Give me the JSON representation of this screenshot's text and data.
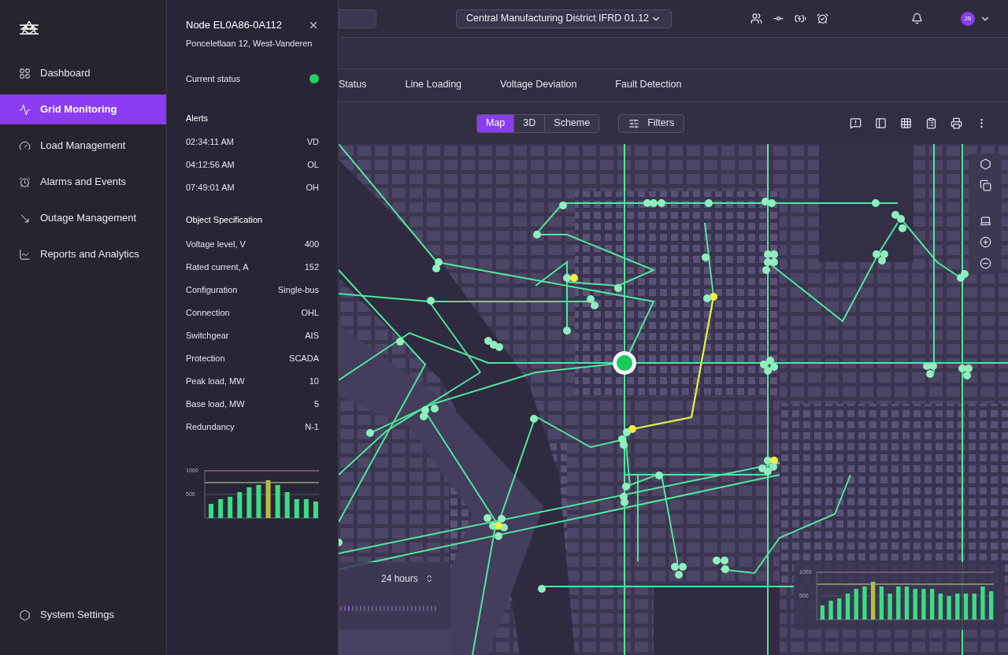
{
  "sidebar": {
    "items": [
      {
        "label": "Dashboard",
        "selected": false
      },
      {
        "label": "Grid Monitoring",
        "selected": true
      },
      {
        "label": "Load Management",
        "selected": false
      },
      {
        "label": "Alarms and Events",
        "selected": false
      },
      {
        "label": "Outage Management",
        "selected": false
      },
      {
        "label": "Reports and Analytics",
        "selected": false
      }
    ],
    "footer": {
      "label": "System Settings",
      "selected": false
    }
  },
  "node_panel": {
    "title": "Node EL0A86-0A112",
    "address": "Ponceletlaan 12, West-Vanderen",
    "status": {
      "label": "Current status",
      "color": "#1fd35c"
    },
    "alerts_title": "Alerts",
    "alerts": [
      {
        "time": "02:34:11 AM",
        "code": "VD"
      },
      {
        "time": "04:12:56 AM",
        "code": "OL"
      },
      {
        "time": "07:49:01 AM",
        "code": "OH"
      }
    ],
    "spec_title": "Object Specification",
    "spec": [
      {
        "label": "Voltage level, V",
        "value": "400"
      },
      {
        "label": "Rated current, A",
        "value": "152"
      },
      {
        "label": "Configuration",
        "value": "Single-bus"
      },
      {
        "label": "Connection",
        "value": "OHL"
      },
      {
        "label": "Switchgear",
        "value": "AIS"
      },
      {
        "label": "Protection",
        "value": "SCADA"
      },
      {
        "label": "Peak load, MW",
        "value": "10"
      },
      {
        "label": "Base load, MW",
        "value": "5"
      },
      {
        "label": "Redundancy",
        "value": "N-1"
      }
    ],
    "chart_data": {
      "type": "bar",
      "ylim": [
        0,
        1000
      ],
      "yticks": [
        500,
        1000
      ],
      "stacked": true,
      "series": [
        {
          "color": "#3ddc84",
          "values": [
            300,
            400,
            450,
            550,
            650,
            700,
            null,
            700,
            550,
            400,
            400,
            350
          ]
        },
        {
          "color": "#b5bd45",
          "values": [
            null,
            null,
            null,
            null,
            null,
            null,
            800,
            null,
            null,
            null,
            null,
            null
          ]
        }
      ]
    }
  },
  "header": {
    "district": "Central Manufacturing District IFRD 01.12",
    "avatar": "JS"
  },
  "tabs": [
    {
      "label": "Status",
      "selected": false
    },
    {
      "label": "Line Loading",
      "selected": false
    },
    {
      "label": "Voltage Deviation",
      "selected": false
    },
    {
      "label": "Fault Detection",
      "selected": false
    }
  ],
  "view_modes": [
    {
      "label": "Map",
      "selected": true
    },
    {
      "label": "3D",
      "selected": false
    },
    {
      "label": "Scheme",
      "selected": false
    }
  ],
  "filters": "Filters",
  "time_range": {
    "label": "24 hours"
  },
  "map_chart": {
    "chart_data": {
      "type": "bar",
      "ylim": [
        0,
        1000
      ],
      "yticks": [
        500,
        1000
      ],
      "stacked": true,
      "series": [
        {
          "color": "#3ddc84",
          "values": [
            300,
            400,
            450,
            550,
            650,
            700,
            null,
            700,
            550,
            700,
            700,
            650,
            650,
            650,
            550,
            500,
            550,
            550,
            550,
            700,
            600
          ]
        },
        {
          "color": "#b5bd45",
          "values": [
            null,
            null,
            null,
            null,
            null,
            null,
            800,
            null,
            null,
            null,
            null,
            null,
            null,
            null,
            null,
            null,
            null,
            null,
            null,
            null,
            null
          ]
        }
      ]
    }
  }
}
